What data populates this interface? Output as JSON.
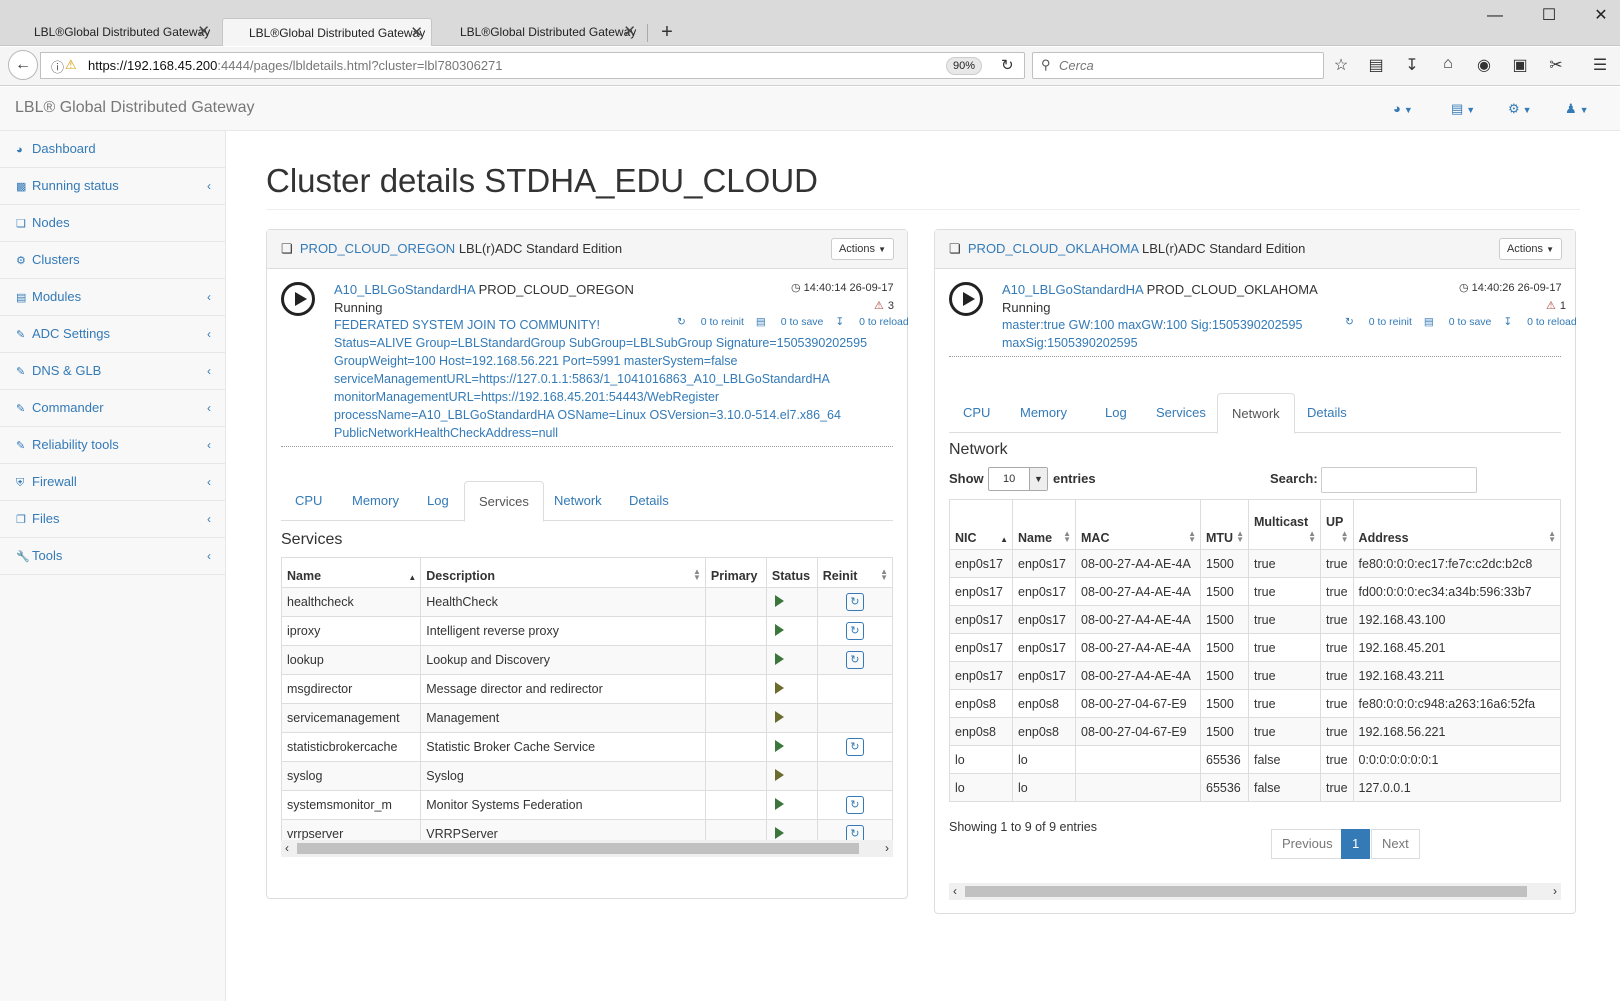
{
  "browser": {
    "tabs": [
      {
        "title": "LBL®Global Distributed Gateway",
        "close": "✕"
      },
      {
        "title": "LBL®Global Distributed Gateway",
        "close": "✕"
      },
      {
        "title": "LBL®Global Distributed Gateway",
        "close": "✕"
      }
    ],
    "new_tab": "+",
    "url_host": "https://192.168.45.200",
    "url_rest": ":4444/pages/lbldetails.html?cluster=lbl780306271",
    "zoom": "90%",
    "search_placeholder": "Cerca"
  },
  "app": {
    "brand": "LBL® Global Distributed Gateway"
  },
  "sidebar": {
    "items": [
      {
        "label": "Dashboard",
        "icon": "dashboard-icon"
      },
      {
        "label": "Running status",
        "icon": "bar-chart-icon"
      },
      {
        "label": "Nodes",
        "icon": "cube-icon"
      },
      {
        "label": "Clusters",
        "icon": "cogs-icon"
      },
      {
        "label": "Modules",
        "icon": "table-icon"
      },
      {
        "label": "ADC Settings",
        "icon": "edit-icon"
      },
      {
        "label": "DNS & GLB",
        "icon": "edit-icon"
      },
      {
        "label": "Commander",
        "icon": "edit-icon"
      },
      {
        "label": "Reliability tools",
        "icon": "edit-icon"
      },
      {
        "label": "Firewall",
        "icon": "shield-icon"
      },
      {
        "label": "Files",
        "icon": "files-icon"
      },
      {
        "label": "Tools",
        "icon": "wrench-icon"
      }
    ]
  },
  "page": {
    "title": "Cluster details STDHA_EDU_CLOUD"
  },
  "left_panel": {
    "name": "PROD_CLOUD_OREGON",
    "edition": "LBL(r)ADC Standard Edition",
    "actions": "Actions",
    "node_link": "A10_LBLGoStandardHA",
    "node_name": "PROD_CLOUD_OREGON",
    "status": "Running",
    "time": "14:40:14 26-09-17",
    "warnings": "3",
    "reinit": "0 to reinit",
    "save": "0 to save",
    "reload": "0 to reload",
    "info": [
      "FEDERATED SYSTEM JOIN TO COMMUNITY!",
      "Status=ALIVE Group=LBLStandardGroup SubGroup=LBLSubGroup Signature=1505390202595",
      "GroupWeight=100 Host=192.168.56.221 Port=5991 masterSystem=false",
      "serviceManagementURL=https://127.0.1.1:5863/1_1041016863_A10_LBLGoStandardHA",
      "monitorManagementURL=https://192.168.45.201:54443/WebRegister",
      "processName=A10_LBLGoStandardHA OSName=Linux OSVersion=3.10.0-514.el7.x86_64",
      "PublicNetworkHealthCheckAddress=null"
    ],
    "tabs": [
      "CPU",
      "Memory",
      "Log",
      "Services",
      "Network",
      "Details"
    ],
    "section": "Services",
    "columns": [
      "Name",
      "Description",
      "Primary",
      "Status",
      "Reinit"
    ],
    "rows": [
      {
        "name": "healthcheck",
        "desc": "HealthCheck",
        "primary": "",
        "reinit": true
      },
      {
        "name": "iproxy",
        "desc": "Intelligent reverse proxy",
        "primary": "",
        "reinit": true
      },
      {
        "name": "lookup",
        "desc": "Lookup and Discovery",
        "primary": "",
        "reinit": true
      },
      {
        "name": "msgdirector",
        "desc": "Message director and redirector",
        "primary": "",
        "reinit": false
      },
      {
        "name": "servicemanagement",
        "desc": "Management",
        "primary": "",
        "reinit": false
      },
      {
        "name": "statisticbrokercache",
        "desc": "Statistic Broker Cache Service",
        "primary": "",
        "reinit": true
      },
      {
        "name": "syslog",
        "desc": "Syslog",
        "primary": "",
        "reinit": false
      },
      {
        "name": "systemsmonitor_m",
        "desc": "Monitor Systems Federation",
        "primary": "",
        "reinit": true
      },
      {
        "name": "vrrpserver",
        "desc": "VRRPServer",
        "primary": "",
        "reinit": true
      }
    ]
  },
  "right_panel": {
    "name": "PROD_CLOUD_OKLAHOMA",
    "edition": "LBL(r)ADC Standard Edition",
    "actions": "Actions",
    "node_link": "A10_LBLGoStandardHA",
    "node_name": "PROD_CLOUD_OKLAHOMA",
    "status": "Running",
    "time": "14:40:26 26-09-17",
    "warnings": "1",
    "reinit": "0 to reinit",
    "save": "0 to save",
    "reload": "0 to reload",
    "info": [
      "master:true GW:100 maxGW:100 Sig:1505390202595",
      "maxSig:1505390202595"
    ],
    "tabs": [
      "CPU",
      "Memory",
      "Log",
      "Services",
      "Network",
      "Details"
    ],
    "section": "Network",
    "show_label": "Show",
    "entries_label": "entries",
    "page_size": "10",
    "search_label": "Search:",
    "columns": [
      "NIC",
      "Name",
      "MAC",
      "MTU",
      "Multicast",
      "UP",
      "Address"
    ],
    "rows": [
      [
        "enp0s17",
        "enp0s17",
        "08-00-27-A4-AE-4A",
        "1500",
        "true",
        "true",
        "fe80:0:0:0:ec17:fe7c:c2dc:b2c8"
      ],
      [
        "enp0s17",
        "enp0s17",
        "08-00-27-A4-AE-4A",
        "1500",
        "true",
        "true",
        "fd00:0:0:0:ec34:a34b:596:33b7"
      ],
      [
        "enp0s17",
        "enp0s17",
        "08-00-27-A4-AE-4A",
        "1500",
        "true",
        "true",
        "192.168.43.100"
      ],
      [
        "enp0s17",
        "enp0s17",
        "08-00-27-A4-AE-4A",
        "1500",
        "true",
        "true",
        "192.168.45.201"
      ],
      [
        "enp0s17",
        "enp0s17",
        "08-00-27-A4-AE-4A",
        "1500",
        "true",
        "true",
        "192.168.43.211"
      ],
      [
        "enp0s8",
        "enp0s8",
        "08-00-27-04-67-E9",
        "1500",
        "true",
        "true",
        "fe80:0:0:0:c948:a263:16a6:52fa"
      ],
      [
        "enp0s8",
        "enp0s8",
        "08-00-27-04-67-E9",
        "1500",
        "true",
        "true",
        "192.168.56.221"
      ],
      [
        "lo",
        "lo",
        "",
        "65536",
        "false",
        "true",
        "0:0:0:0:0:0:0:1"
      ],
      [
        "lo",
        "lo",
        "",
        "65536",
        "false",
        "true",
        "127.0.0.1"
      ]
    ],
    "showing": "Showing 1 to 9 of 9 entries",
    "pager": {
      "prev": "Previous",
      "page": "1",
      "next": "Next"
    }
  },
  "colors": {
    "link": "#337ab7",
    "running": "#3c763d",
    "warning": "#a94442"
  }
}
